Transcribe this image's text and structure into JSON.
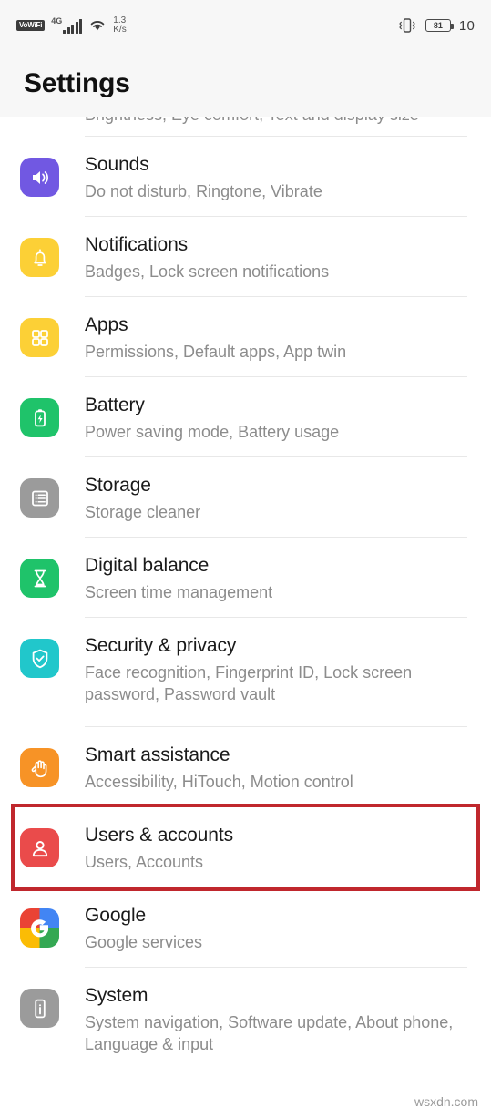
{
  "statusbar": {
    "vowifi_label": "VoWiFi",
    "network_label": "4G",
    "data_speed_value": "1.3",
    "data_speed_unit": "K/s",
    "battery_level": "81",
    "clock": "10"
  },
  "header": {
    "title": "Settings"
  },
  "clipped_row": {
    "sub": "Brightness, Eye comfort, Text and display size"
  },
  "rows": [
    {
      "title": "Sounds",
      "sub": "Do not disturb, Ringtone, Vibrate",
      "icon": "speaker-icon",
      "icon_color": "#7158e2"
    },
    {
      "title": "Notifications",
      "sub": "Badges, Lock screen notifications",
      "icon": "bell-icon",
      "icon_color": "#fcd036"
    },
    {
      "title": "Apps",
      "sub": "Permissions, Default apps, App twin",
      "icon": "grid-icon",
      "icon_color": "#fcd036"
    },
    {
      "title": "Battery",
      "sub": "Power saving mode, Battery usage",
      "icon": "battery-icon",
      "icon_color": "#1fc36a"
    },
    {
      "title": "Storage",
      "sub": "Storage cleaner",
      "icon": "storage-icon",
      "icon_color": "#9b9b9b"
    },
    {
      "title": "Digital balance",
      "sub": "Screen time management",
      "icon": "hourglass-icon",
      "icon_color": "#1fc36a"
    },
    {
      "title": "Security & privacy",
      "sub": "Face recognition, Fingerprint ID, Lock screen password, Password vault",
      "icon": "shield-check-icon",
      "icon_color": "#21c7cb"
    },
    {
      "title": "Smart assistance",
      "sub": "Accessibility, HiTouch, Motion control",
      "icon": "hand-icon",
      "icon_color": "#f79326"
    },
    {
      "title": "Users & accounts",
      "sub": "Users, Accounts",
      "icon": "person-icon",
      "icon_color": "#ea4b4b",
      "highlighted": true
    },
    {
      "title": "Google",
      "sub": "Google services",
      "icon": "google-logo-icon",
      "icon_color": "#ffffff"
    },
    {
      "title": "System",
      "sub": "System navigation, Software update, About phone, Language & input",
      "icon": "phone-info-icon",
      "icon_color": "#9b9b9b"
    }
  ],
  "annotation": {
    "highlight_color": "#c0272d",
    "highlight_target": "Users & accounts"
  },
  "watermark": {
    "text": "wsxdn.com"
  }
}
